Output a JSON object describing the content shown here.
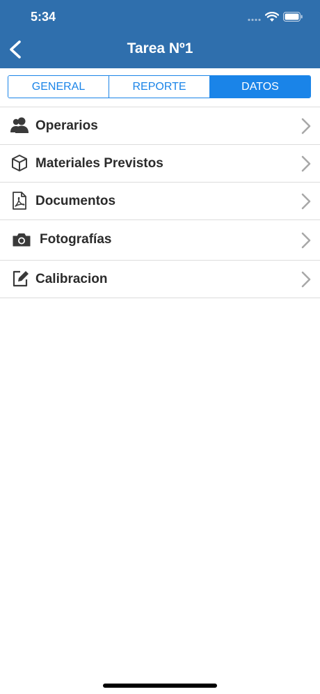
{
  "status_bar": {
    "time": "5:34"
  },
  "nav": {
    "title": "Tarea Nº1"
  },
  "tabs": [
    {
      "label": "GENERAL",
      "selected": false
    },
    {
      "label": "REPORTE",
      "selected": false
    },
    {
      "label": "DATOS",
      "selected": true
    }
  ],
  "menu": [
    {
      "label": "Operarios",
      "icon": "users-icon"
    },
    {
      "label": "Materiales Previstos",
      "icon": "box-icon"
    },
    {
      "label": "Documentos",
      "icon": "pdf-document-icon"
    },
    {
      "label": "Fotografías",
      "icon": "camera-icon"
    },
    {
      "label": "Calibracion",
      "icon": "edit-icon"
    }
  ],
  "colors": {
    "header": "#2f6fad",
    "accent": "#1a84e8",
    "text": "#2b2b2b",
    "chevron": "#a8a8a8",
    "divider": "#dcdcdc"
  }
}
